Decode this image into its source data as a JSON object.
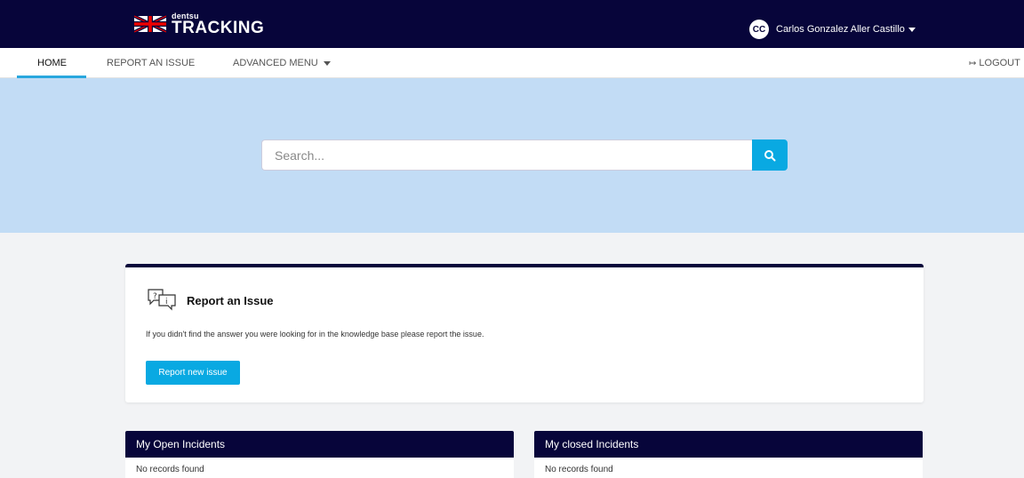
{
  "header": {
    "brand_small": "dentsu",
    "brand_big": "TRACKING",
    "user_initials": "CC",
    "user_name": "Carlos Gonzalez Aller Castillo"
  },
  "nav": {
    "items": [
      {
        "label": "HOME",
        "active": true
      },
      {
        "label": "REPORT AN ISSUE",
        "active": false
      },
      {
        "label": "ADVANCED MENU",
        "active": false
      }
    ],
    "logout_label": "LOGOUT"
  },
  "search": {
    "placeholder": "Search..."
  },
  "report_card": {
    "title": "Report an Issue",
    "text": "If you didn't find the answer you were looking for in the knowledge base please report the issue.",
    "button_label": "Report new issue"
  },
  "panels": [
    {
      "title": "My Open Incidents",
      "empty_text": "No records found"
    },
    {
      "title": "My closed Incidents",
      "empty_text": "No records found"
    }
  ],
  "colors": {
    "primary_navy": "#07053a",
    "accent_blue": "#09a9e2",
    "hero_bg": "#c2dcf5",
    "nav_underline": "#29a7de"
  },
  "icons": {
    "flag": "uk-flag-icon",
    "search": "search-icon",
    "logout": "logout-icon",
    "report": "speech-bubbles-icon",
    "dropdown": "chevron-down-icon"
  }
}
